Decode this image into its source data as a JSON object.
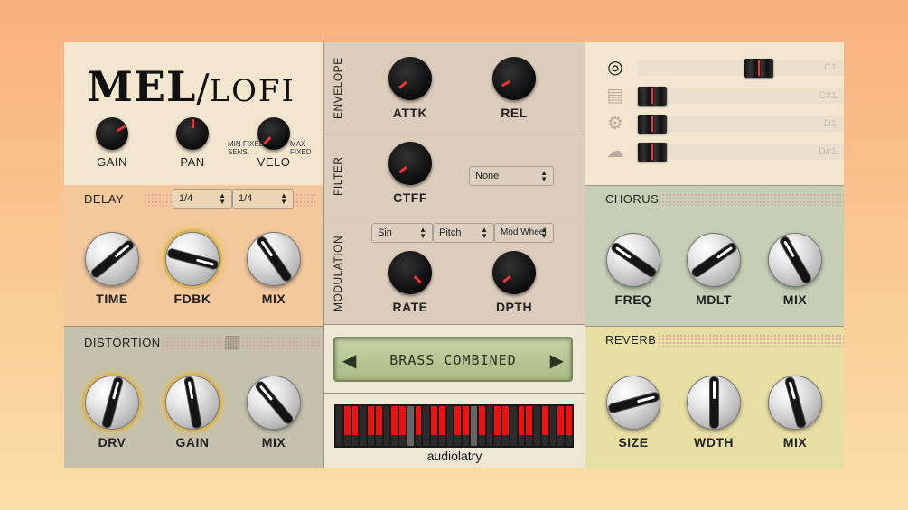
{
  "brand": {
    "title_main": "MEL",
    "title_sub": "LOFI",
    "company": "audiolatry"
  },
  "main": {
    "knobs": [
      {
        "label": "GAIN",
        "angle": 60
      },
      {
        "label": "PAN",
        "angle": 0
      },
      {
        "label": "VELO",
        "angle": 225
      }
    ],
    "velo_min": "MIN FIXED",
    "velo_sens": "SENS.",
    "velo_max": "MAX FIXED"
  },
  "delay": {
    "title": "DELAY",
    "sync_left": "1/4",
    "sync_right": "1/4",
    "knobs": [
      {
        "label": "TIME",
        "angle": 50
      },
      {
        "label": "FDBK",
        "angle": 105
      },
      {
        "label": "MIX",
        "angle": -35
      }
    ]
  },
  "distortion": {
    "title": "DISTORTION",
    "knobs": [
      {
        "label": "DRV",
        "angle": 15
      },
      {
        "label": "GAIN",
        "angle": -10
      },
      {
        "label": "MIX",
        "angle": -40
      }
    ]
  },
  "envelope": {
    "title": "ENVELOPE",
    "knobs": [
      {
        "label": "ATTK",
        "angle": 230
      },
      {
        "label": "REL",
        "angle": 240
      }
    ]
  },
  "filter": {
    "title": "FILTER",
    "knob": {
      "label": "CTFF",
      "angle": 230
    },
    "type_value": "None"
  },
  "modulation": {
    "title": "MODULATION",
    "shape": "Sin",
    "target": "Pitch",
    "source": "Mod Wheel",
    "knobs": [
      {
        "label": "RATE",
        "angle": 135
      },
      {
        "label": "DPTH",
        "angle": 230
      }
    ]
  },
  "display": {
    "preset_name": "BRASS COMBINED",
    "prev": "◀",
    "next": "▶"
  },
  "keyboard": {
    "lit_keys": [
      1,
      2,
      4,
      5,
      7,
      8,
      10,
      12,
      13,
      15,
      16,
      18,
      20,
      21,
      23,
      24,
      26,
      28,
      29
    ],
    "grey_keys": [
      9,
      17
    ]
  },
  "mapping": {
    "rows": [
      {
        "icon": "target-icon",
        "note": "C1",
        "value": 0.6
      },
      {
        "icon": "radio-icon",
        "note": "C#1",
        "value": 0.0
      },
      {
        "icon": "gear-icon",
        "note": "D1",
        "value": 0.0
      },
      {
        "icon": "cloud-icon",
        "note": "D#1",
        "value": 0.0
      }
    ]
  },
  "chorus": {
    "title": "CHORUS",
    "knobs": [
      {
        "label": "FREQ",
        "angle": -55
      },
      {
        "label": "MDLT",
        "angle": 55
      },
      {
        "label": "MIX",
        "angle": -30
      }
    ]
  },
  "reverb": {
    "title": "REVERB",
    "knobs": [
      {
        "label": "SIZE",
        "angle": 75
      },
      {
        "label": "WDTH",
        "angle": 0
      },
      {
        "label": "MIX",
        "angle": -15
      }
    ]
  },
  "colors": {
    "bg_top": "#f8b07f",
    "bg_bottom": "#fbe0a6",
    "accent": "#e33333"
  }
}
